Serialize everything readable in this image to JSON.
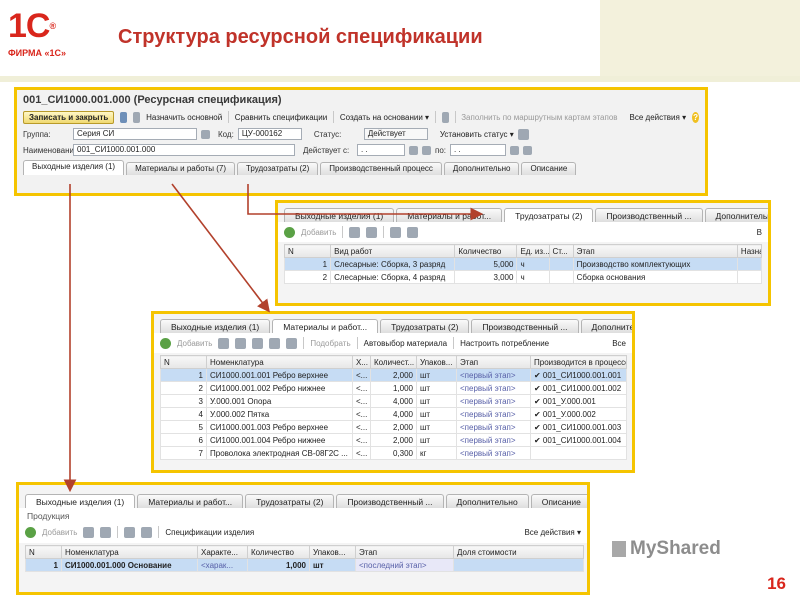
{
  "header": {
    "logo_text": "1С",
    "logo_firm": "ФИРМА «1С»",
    "title": "Структура ресурсной спецификации"
  },
  "spec_window": {
    "title": "001_СИ1000.001.000 (Ресурсная спецификация)",
    "toolbar": [
      "Записать и закрыть",
      "Назначить основной",
      "Сравнить спецификации",
      "Создать на основании ▾",
      "Заполнить по маршрутным картам этапов",
      "Все действия ▾"
    ],
    "fields": {
      "group_label": "Группа:",
      "group_value": "Серия СИ",
      "code_label": "Код:",
      "code_value": "ЦУ-000162",
      "status_label": "Статус:",
      "status_value": "Действует",
      "set_status": "Установить статус ▾",
      "name_label": "Наименование:",
      "name_value": "001_СИ1000.001.000",
      "valid_from_label": "Действует с:",
      "valid_from_value": ". .",
      "to_label": "по:",
      "to_value": ". ."
    },
    "tabs": [
      "Выходные изделия (1)",
      "Материалы и работы (7)",
      "Трудозатраты (2)",
      "Производственный процесс",
      "Дополнительно",
      "Описание"
    ]
  },
  "labor_panel": {
    "tabs": [
      "Выходные изделия (1)",
      "Материалы и работ...",
      "Трудозатраты (2)",
      "Производственный ...",
      "Дополнительно"
    ],
    "toolbar": [
      "Добавить",
      "В"
    ],
    "columns": [
      "N",
      "Вид работ",
      "Количество",
      "Ед. из...",
      "Ст...",
      "Этап",
      "Назна"
    ],
    "rows": [
      {
        "n": "1",
        "work": "Слесарные: Сборка, 3 разряд",
        "qty": "5,000",
        "unit": "ч",
        "st": "",
        "stage": "Производство комплектующих"
      },
      {
        "n": "2",
        "work": "Слесарные: Сборка, 4 разряд",
        "qty": "3,000",
        "unit": "ч",
        "st": "",
        "stage": "Сборка основания"
      }
    ]
  },
  "materials_panel": {
    "tabs": [
      "Выходные изделия (1)",
      "Материалы и работ...",
      "Трудозатраты (2)",
      "Производственный ...",
      "Дополнительно"
    ],
    "toolbar": [
      "Добавить",
      "Подобрать",
      "Автовыбор материала",
      "Настроить потребление",
      "Все"
    ],
    "columns": [
      "N",
      "Номенклатура",
      "Х...",
      "Количест...",
      "Упаков...",
      "Этап",
      "Производится в процессе"
    ],
    "rows": [
      {
        "n": "1",
        "item": "СИ1000.001.001 Ребро верхнее",
        "x": "<...",
        "qty": "2,000",
        "pack": "шт",
        "stage": "<первый этап>",
        "proc": "✔ 001_СИ1000.001.001"
      },
      {
        "n": "2",
        "item": "СИ1000.001.002 Ребро нижнее",
        "x": "<...",
        "qty": "1,000",
        "pack": "шт",
        "stage": "<первый этап>",
        "proc": "✔ 001_СИ1000.001.002"
      },
      {
        "n": "3",
        "item": "У.000.001 Опора",
        "x": "<...",
        "qty": "4,000",
        "pack": "шт",
        "stage": "<первый этап>",
        "proc": "✔ 001_У.000.001"
      },
      {
        "n": "4",
        "item": "У.000.002 Пятка",
        "x": "<...",
        "qty": "4,000",
        "pack": "шт",
        "stage": "<первый этап>",
        "proc": "✔ 001_У.000.002"
      },
      {
        "n": "5",
        "item": "СИ1000.001.003 Ребро верхнее",
        "x": "<...",
        "qty": "2,000",
        "pack": "шт",
        "stage": "<первый этап>",
        "proc": "✔ 001_СИ1000.001.003"
      },
      {
        "n": "6",
        "item": "СИ1000.001.004 Ребро нижнее",
        "x": "<...",
        "qty": "2,000",
        "pack": "шт",
        "stage": "<первый этап>",
        "proc": "✔ 001_СИ1000.001.004"
      },
      {
        "n": "7",
        "item": "Проволока электродная СВ-08Г2С ...",
        "x": "<...",
        "qty": "0,300",
        "pack": "кг",
        "stage": "<первый этап>",
        "proc": ""
      }
    ]
  },
  "output_panel": {
    "tabs": [
      "Выходные изделия (1)",
      "Материалы и работ...",
      "Трудозатраты (2)",
      "Производственный ...",
      "Дополнительно",
      "Описание"
    ],
    "group_label": "Продукция",
    "toolbar": [
      "Добавить",
      "Спецификации изделия",
      "Все действия ▾"
    ],
    "columns": [
      "N",
      "Номенклатура",
      "Характе...",
      "Количество",
      "Упаков...",
      "Этап",
      "Доля стоимости"
    ],
    "rows": [
      {
        "n": "1",
        "item": "СИ1000.001.000 Основание",
        "char": "<харак...",
        "qty": "1,000",
        "pack": "шт",
        "stage": "<последний этап>",
        "share": ""
      }
    ]
  },
  "watermark": "MyShared",
  "page_number": "16",
  "colors": {
    "accent_red": "#d9261c",
    "frame_yellow": "#f5c400",
    "arrow": "#b2412c",
    "selection": "#c6dcf4"
  }
}
